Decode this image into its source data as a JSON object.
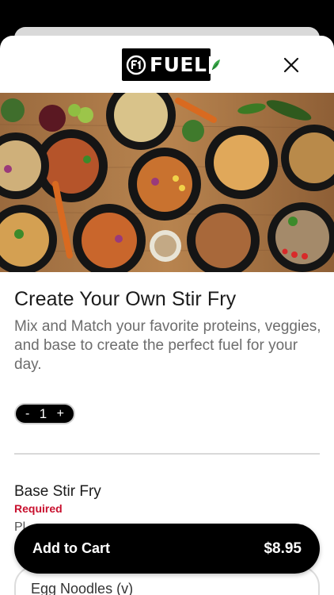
{
  "brand": {
    "logo_text": "FUEL",
    "logo_mark": "F"
  },
  "header": {
    "close_label": "close"
  },
  "hero": {
    "alt": ""
  },
  "product": {
    "title": "Create Your Own Stir Fry",
    "description": "Mix and Match your favorite proteins, veggies, and base to create the perfect fuel for your day."
  },
  "quantity": {
    "minus": "-",
    "value": "1",
    "plus": "+"
  },
  "section": {
    "title": "Base Stir Fry",
    "required_label": "Required",
    "peek_text": "Pl"
  },
  "options": [
    {
      "label": "Egg Noodles (v)"
    }
  ],
  "cart": {
    "label": "Add to Cart",
    "price": "$8.95"
  },
  "colors": {
    "accent": "#000000",
    "required": "#c8102e",
    "leaf": "#3aa84a"
  }
}
